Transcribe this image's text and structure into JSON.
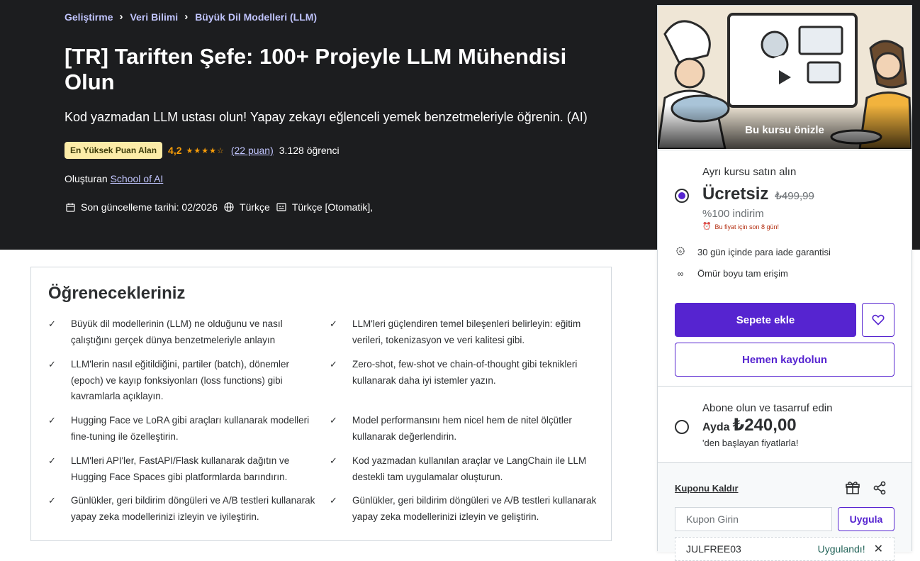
{
  "breadcrumb": [
    "Geliştirme",
    "Veri Bilimi",
    "Büyük Dil Modelleri (LLM)"
  ],
  "course": {
    "title": "[TR] Tariften Şefe: 100+ Projeyle LLM Mühendisi Olun",
    "subtitle": "Kod yazmadan LLM ustası olun! Yapay zekayı eğlenceli yemek benzetmeleriyle öğrenin. (AI)",
    "badge": "En Yüksek Puan Alan",
    "rating": "4,2",
    "stars_value": 4.2,
    "rating_count": "(22 puan)",
    "students": "3.128 öğrenci",
    "creator_label": "Oluşturan",
    "creator_name": "School of AI",
    "updated": "Son güncelleme tarihi: 02/2026",
    "language": "Türkçe",
    "captions": "Türkçe [Otomatik],"
  },
  "learn": {
    "heading": "Öğrenecekleriniz",
    "items": [
      "Büyük dil modellerinin (LLM) ne olduğunu ve nasıl çalıştığını gerçek dünya benzetmeleriyle anlayın",
      "LLM'leri güçlendiren temel bileşenleri belirleyin: eğitim verileri, tokenizasyon ve veri kalitesi gibi.",
      "LLM'lerin nasıl eğitildiğini, partiler (batch), dönemler (epoch) ve kayıp fonksiyonları (loss functions) gibi kavramlarla açıklayın.",
      "Zero-shot, few-shot ve chain-of-thought gibi teknikleri kullanarak daha iyi istemler yazın.",
      "Hugging Face ve LoRA gibi araçları kullanarak modelleri fine-tuning ile özelleştirin.",
      "Model performansını hem nicel hem de nitel ölçütler kullanarak değerlendirin.",
      "LLM'leri API'ler, FastAPI/Flask kullanarak dağıtın ve Hugging Face Spaces gibi platformlarda barındırın.",
      "Kod yazmadan kullanılan araçlar ve LangChain ile LLM destekli tam uygulamalar oluşturun.",
      "Günlükler, geri bildirim döngüleri ve A/B testleri kullanarak yapay zeka modellerinizi izleyin ve iyileştirin.",
      "Günlükler, geri bildirim döngüleri ve A/B testleri kullanarak yapay zeka modellerinizi izleyin ve geliştirin."
    ]
  },
  "sidebar": {
    "preview_label": "Bu kursu önizle",
    "buy": {
      "heading": "Ayrı kursu satın alın",
      "price": "Ücretsiz",
      "old_price": "₺499,99",
      "discount": "%100 indirim",
      "timer": "Bu fiyat için son 8 gün!",
      "features": [
        "30 gün içinde para iade garantisi",
        "Ömür boyu tam erişim"
      ],
      "cart_button": "Sepete ekle",
      "enroll_button": "Hemen kaydolun"
    },
    "subscribe": {
      "heading": "Abone olun ve tasarruf edin",
      "monthly_label": "Ayda",
      "monthly_price": "₺240,00",
      "from_text": "'den başlayan fiyatlarla!"
    },
    "coupon": {
      "remove_label": "Kuponu Kaldır",
      "placeholder": "Kupon Girin",
      "apply_button": "Uygula",
      "applied_code": "JULFREE03",
      "applied_status": "Uygulandı!"
    }
  },
  "colors": {
    "accent": "#5624d0",
    "hero_bg": "#1c1d1f",
    "star": "#f69c08",
    "link_light": "#c0c4fc"
  }
}
